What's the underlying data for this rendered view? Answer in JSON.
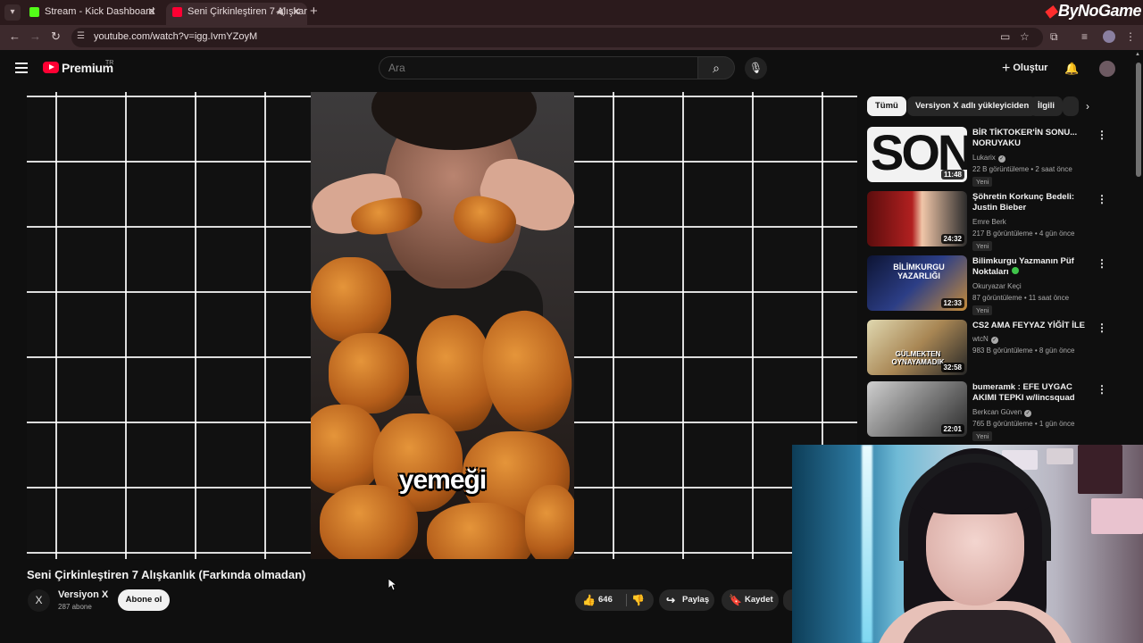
{
  "browser": {
    "tabs": [
      {
        "label": "Stream - Kick Dashboard"
      },
      {
        "label": "Seni Çirkinleştiren 7 Alışkan"
      }
    ],
    "url": "youtube.com/watch?v=igg.IvmYZoyM",
    "brand_overlay": "ByNoGame"
  },
  "header": {
    "logo_text": "Premium",
    "logo_badge": "TR",
    "search_placeholder": "Ara",
    "create_label": "Oluştur"
  },
  "player": {
    "caption": "yemeği"
  },
  "video": {
    "title": "Seni Çirkinleştiren 7 Alışkanlık (Farkında olmadan)",
    "channel_name": "Versiyon X",
    "channel_initial": "X",
    "subscribers": "287 abone",
    "subscribe_label": "Abone ol",
    "likes": "646",
    "share_label": "Paylaş",
    "save_label": "Kaydet"
  },
  "sidebar": {
    "chips": [
      {
        "label": "Tümü",
        "active": true
      },
      {
        "label": "Versiyon X adlı yükleyiciden",
        "active": false
      },
      {
        "label": "İlgili",
        "active": false
      }
    ],
    "recommendations": [
      {
        "title": "BİR TİKTOKER'İN SONU... NORUYAKU",
        "channel": "Lukarix",
        "verified": true,
        "meta": "22 B görüntüleme • 2 saat önce",
        "badge": "Yeni",
        "duration": "11:48",
        "thumb_text": "SON"
      },
      {
        "title": "Şöhretin Korkunç Bedeli: Justin Bieber",
        "channel": "Emre Berk",
        "verified": false,
        "meta": "217 B görüntüleme • 4 gün önce",
        "badge": "Yeni",
        "duration": "24:32",
        "thumb_text": ""
      },
      {
        "title": "Bilimkurgu Yazmanın Püf Noktaları",
        "channel": "Okuryazar Keçi",
        "verified": false,
        "meta": "87 görüntüleme • 11 saat önce",
        "badge": "Yeni",
        "duration": "12:33",
        "thumb_text": "BİLİMKURGU YAZARLIĞI"
      },
      {
        "title": "CS2 AMA FEYYAZ YİĞİT İLE",
        "channel": "wtcN",
        "verified": true,
        "meta": "983 B görüntüleme • 8 gün önce",
        "badge": "",
        "duration": "32:58",
        "thumb_text": "GÜLMEKTEN OYNAYAMADIK"
      },
      {
        "title": "bumeramk : EFE UYGAC AKIMI TEPKI w/lincsquad",
        "channel": "Berkcan Güven",
        "verified": true,
        "meta": "765 B görüntüleme • 1 gün önce",
        "badge": "Yeni",
        "duration": "22:01",
        "thumb_text": ""
      }
    ]
  }
}
